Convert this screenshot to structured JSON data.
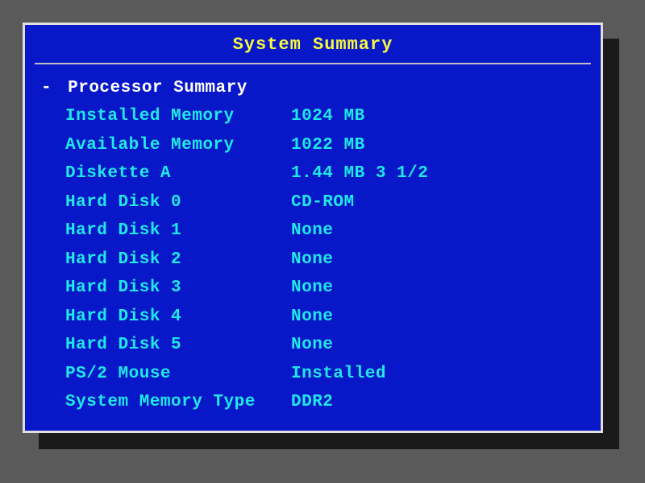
{
  "title": "System Summary",
  "section": {
    "marker": "-",
    "header": "Processor Summary"
  },
  "rows": [
    {
      "label": "Installed Memory",
      "value": "1024 MB"
    },
    {
      "label": "Available Memory",
      "value": "1022 MB"
    },
    {
      "label": "Diskette A",
      "value": "1.44 MB 3 1/2"
    },
    {
      "label": "Hard Disk 0",
      "value": "CD-ROM"
    },
    {
      "label": "Hard Disk 1",
      "value": "None"
    },
    {
      "label": "Hard Disk 2",
      "value": "None"
    },
    {
      "label": "Hard Disk 3",
      "value": "None"
    },
    {
      "label": "Hard Disk 4",
      "value": "None"
    },
    {
      "label": "Hard Disk 5",
      "value": "None"
    },
    {
      "label": "PS/2 Mouse",
      "value": "Installed"
    },
    {
      "label": "System Memory Type",
      "value": "DDR2"
    }
  ]
}
